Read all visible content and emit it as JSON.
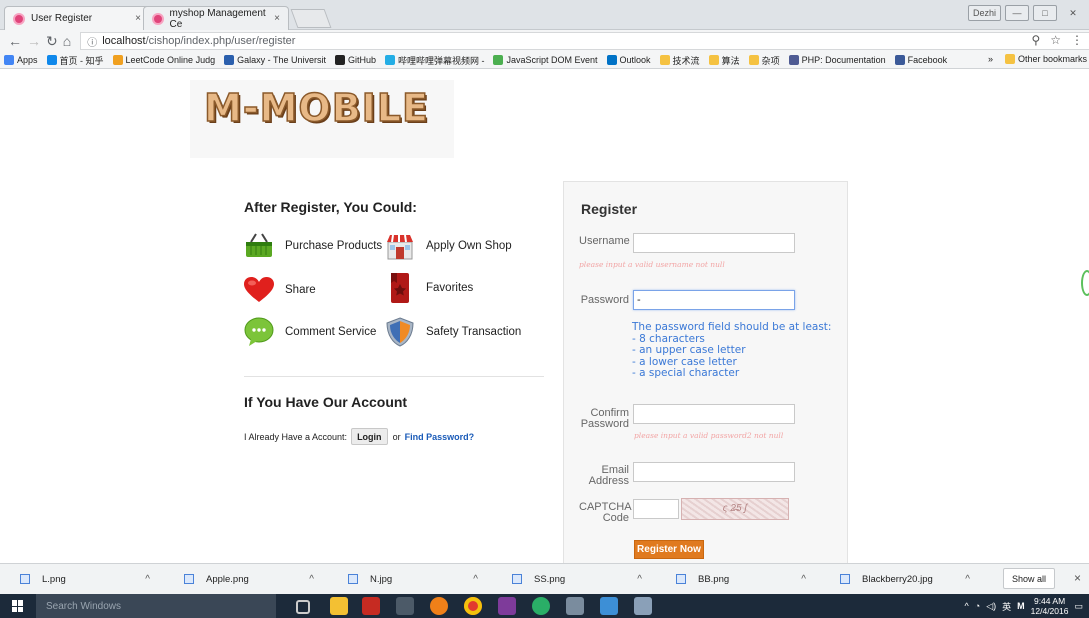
{
  "browser": {
    "tabs": [
      {
        "title": "User Register",
        "close": "×"
      },
      {
        "title": "myshop Management Ce",
        "close": "×"
      }
    ],
    "url_host": "localhost",
    "url_path": "/cishop/index.php/user/register",
    "window_button_profile": "Dezhi",
    "bookmarks": [
      {
        "label": "Apps",
        "color": "#4285f4"
      },
      {
        "label": "首页 - 知乎",
        "color": "#0f88eb"
      },
      {
        "label": "LeetCode Online Judg",
        "color": "#f0a020"
      },
      {
        "label": "Galaxy - The Universit",
        "color": "#2b5fad"
      },
      {
        "label": "GitHub",
        "color": "#222222"
      },
      {
        "label": "哔哩哔哩弹幕视频网 -",
        "color": "#23ade5"
      },
      {
        "label": "JavaScript DOM Event",
        "color": "#4caf50"
      },
      {
        "label": "Outlook",
        "color": "#0072c6"
      },
      {
        "label": "技术流",
        "color": "#f5c242"
      },
      {
        "label": "算法",
        "color": "#f5c242"
      },
      {
        "label": "杂项",
        "color": "#f5c242"
      },
      {
        "label": "PHP: Documentation",
        "color": "#4f5b93"
      },
      {
        "label": "Facebook",
        "color": "#3b5998"
      }
    ],
    "bookmarks_more": "»",
    "other_bookmarks": "Other bookmarks"
  },
  "logo": "M-MOBILE",
  "benefits": {
    "heading": "After Register, You Could:",
    "items": [
      {
        "label": "Purchase Products",
        "icon": "basket-icon"
      },
      {
        "label": "Apply Own Shop",
        "icon": "shop-icon"
      },
      {
        "label": "Share",
        "icon": "heart-icon"
      },
      {
        "label": "Favorites",
        "icon": "bookmark-icon"
      },
      {
        "label": "Comment Service",
        "icon": "comment-icon"
      },
      {
        "label": "Safety Transaction",
        "icon": "shield-icon"
      }
    ]
  },
  "account": {
    "heading": "If You Have Our Account",
    "text": "I Already Have a Account:",
    "login_label": "Login",
    "or": "or",
    "find_password": "Find Password?"
  },
  "register": {
    "title": "Register",
    "username_label": "Username",
    "username_error": "please input a valid username not null",
    "password_label": "Password",
    "password_value": "-",
    "password_hint": [
      "The password field should be at least:",
      "- 8 characters",
      "- an upper case letter",
      "- a lower case letter",
      "- a special character"
    ],
    "confirm_label_1": "Confirm",
    "confirm_label_2": "Password",
    "confirm_error": "please input a valid password2 not null",
    "email_label_1": "Email",
    "email_label_2": "Address",
    "captcha_label_1": "CAPTCHA",
    "captcha_label_2": "Code",
    "captcha_image_text": "ς 2̶5 ʃ",
    "submit": "Register Now"
  },
  "downloads": {
    "files": [
      "L.png",
      "Apple.png",
      "N.jpg",
      "SS.png",
      "BB.png",
      "Blackberry20.jpg"
    ],
    "show_all": "Show all",
    "close": "×"
  },
  "taskbar": {
    "search_placeholder": "Search Windows",
    "ime": "英",
    "time": "9:44 AM",
    "date": "12/4/2016"
  }
}
